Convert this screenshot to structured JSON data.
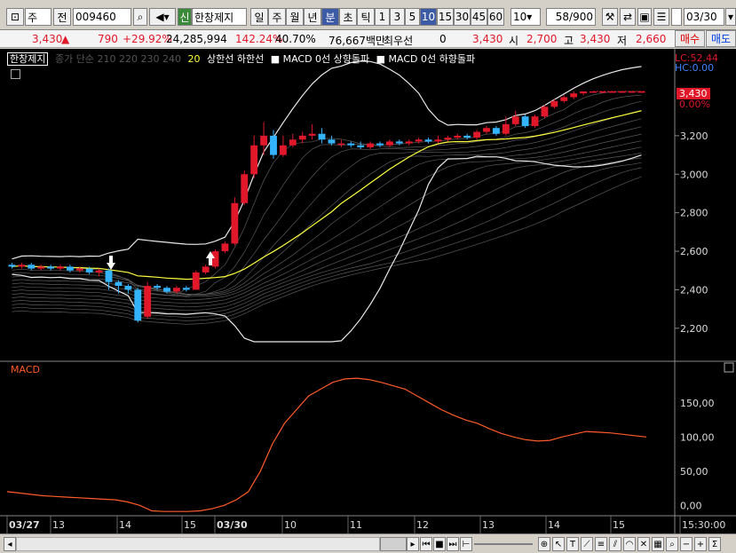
{
  "toolbar": {
    "period_type": "주",
    "market": "전",
    "code": "009460",
    "badge": "신",
    "name": "한창제지",
    "periods": [
      "일",
      "주",
      "월",
      "년",
      "분",
      "초",
      "틱"
    ],
    "active_period": "분",
    "intervals": [
      "1",
      "3",
      "5",
      "10",
      "15",
      "30",
      "45",
      "60"
    ],
    "active_interval": "10",
    "count_select": "10",
    "page_count": "58",
    "page_total": "/900",
    "date_value": "03/30"
  },
  "infobar": {
    "price": "3,430",
    "change": "790",
    "change_pct": "+29.92%",
    "volume": "24,285,994",
    "vol_ratio": "142.24%",
    "turnover": "40.70%",
    "amount": "76,667백만",
    "priority_label": "최우선",
    "priority_value": "0",
    "ask_price": "3,430",
    "open_label": "시",
    "open_value": "2,700",
    "high_label": "고",
    "high_value": "3,430",
    "low_label": "저",
    "low_value": "2,660",
    "buy_button": "매수",
    "sell_button": "매도"
  },
  "legend": {
    "stock_name": "한창제지",
    "ma_label": "종가 단순",
    "ma_periods": [
      "210",
      "220",
      "230",
      "240"
    ],
    "ma_20": "20",
    "upper_lower": "상한선  하한선",
    "macd_up": "MACD 0선 상향돌파",
    "macd_down": "MACD 0선 하향돌파"
  },
  "indicators": {
    "lc": "LC:52.44",
    "hc": "HC:0.00",
    "current_price": "3,430",
    "current_pct": "0.00%"
  },
  "macd": {
    "title": "MACD"
  },
  "chart_data": {
    "type": "candlestick",
    "price_axis": {
      "ticks": [
        3200,
        3000,
        2800,
        2600,
        2400,
        2200
      ],
      "labels": [
        "3,200",
        "3,000",
        "2,800",
        "2,600",
        "2,400",
        "2,200"
      ],
      "ylim": [
        2100,
        3430
      ]
    },
    "time_axis": [
      "03/27",
      "13",
      "14",
      "15",
      "03/30",
      "10",
      "11",
      "12",
      "13",
      "14",
      "15",
      "15:30:00"
    ],
    "macd_axis": {
      "ticks": [
        150,
        100,
        50,
        0
      ],
      "labels": [
        "150,00",
        "100,00",
        "50,00",
        "0,00"
      ]
    },
    "candles": [
      {
        "o": 2530,
        "c": 2520,
        "h": 2540,
        "l": 2510
      },
      {
        "o": 2520,
        "c": 2530,
        "h": 2540,
        "l": 2510
      },
      {
        "o": 2530,
        "c": 2510,
        "h": 2540,
        "l": 2500
      },
      {
        "o": 2510,
        "c": 2520,
        "h": 2530,
        "l": 2500
      },
      {
        "o": 2520,
        "c": 2510,
        "h": 2530,
        "l": 2500
      },
      {
        "o": 2510,
        "c": 2520,
        "h": 2530,
        "l": 2500
      },
      {
        "o": 2520,
        "c": 2500,
        "h": 2530,
        "l": 2490
      },
      {
        "o": 2500,
        "c": 2510,
        "h": 2520,
        "l": 2490
      },
      {
        "o": 2510,
        "c": 2490,
        "h": 2520,
        "l": 2480
      },
      {
        "o": 2490,
        "c": 2500,
        "h": 2510,
        "l": 2470
      },
      {
        "o": 2500,
        "c": 2440,
        "h": 2510,
        "l": 2400
      },
      {
        "o": 2440,
        "c": 2420,
        "h": 2450,
        "l": 2380
      },
      {
        "o": 2420,
        "c": 2400,
        "h": 2430,
        "l": 2380
      },
      {
        "o": 2400,
        "c": 2240,
        "h": 2410,
        "l": 2230
      },
      {
        "o": 2260,
        "c": 2420,
        "h": 2440,
        "l": 2250
      },
      {
        "o": 2420,
        "c": 2410,
        "h": 2430,
        "l": 2400
      },
      {
        "o": 2410,
        "c": 2390,
        "h": 2420,
        "l": 2380
      },
      {
        "o": 2390,
        "c": 2410,
        "h": 2420,
        "l": 2380
      },
      {
        "o": 2410,
        "c": 2400,
        "h": 2420,
        "l": 2390
      },
      {
        "o": 2400,
        "c": 2490,
        "h": 2500,
        "l": 2400
      },
      {
        "o": 2490,
        "c": 2520,
        "h": 2530,
        "l": 2480
      },
      {
        "o": 2520,
        "c": 2600,
        "h": 2610,
        "l": 2510
      },
      {
        "o": 2600,
        "c": 2640,
        "h": 2650,
        "l": 2590
      },
      {
        "o": 2640,
        "c": 2850,
        "h": 2880,
        "l": 2630
      },
      {
        "o": 2850,
        "c": 3000,
        "h": 3020,
        "l": 2840
      },
      {
        "o": 3000,
        "c": 3150,
        "h": 3200,
        "l": 2980
      },
      {
        "o": 3150,
        "c": 3200,
        "h": 3270,
        "l": 3100
      },
      {
        "o": 3200,
        "c": 3100,
        "h": 3230,
        "l": 3080
      },
      {
        "o": 3100,
        "c": 3150,
        "h": 3200,
        "l": 3090
      },
      {
        "o": 3150,
        "c": 3180,
        "h": 3210,
        "l": 3140
      },
      {
        "o": 3180,
        "c": 3200,
        "h": 3220,
        "l": 3160
      },
      {
        "o": 3200,
        "c": 3210,
        "h": 3260,
        "l": 3180
      },
      {
        "o": 3210,
        "c": 3180,
        "h": 3240,
        "l": 3160
      },
      {
        "o": 3180,
        "c": 3160,
        "h": 3200,
        "l": 3150
      },
      {
        "o": 3160,
        "c": 3160,
        "h": 3180,
        "l": 3140
      },
      {
        "o": 3160,
        "c": 3150,
        "h": 3170,
        "l": 3140
      },
      {
        "o": 3150,
        "c": 3140,
        "h": 3170,
        "l": 3130
      },
      {
        "o": 3140,
        "c": 3160,
        "h": 3170,
        "l": 3130
      },
      {
        "o": 3160,
        "c": 3150,
        "h": 3170,
        "l": 3140
      },
      {
        "o": 3150,
        "c": 3170,
        "h": 3180,
        "l": 3140
      },
      {
        "o": 3170,
        "c": 3160,
        "h": 3180,
        "l": 3150
      },
      {
        "o": 3160,
        "c": 3170,
        "h": 3180,
        "l": 3150
      },
      {
        "o": 3170,
        "c": 3180,
        "h": 3190,
        "l": 3160
      },
      {
        "o": 3180,
        "c": 3170,
        "h": 3190,
        "l": 3160
      },
      {
        "o": 3170,
        "c": 3180,
        "h": 3200,
        "l": 3160
      },
      {
        "o": 3180,
        "c": 3190,
        "h": 3200,
        "l": 3170
      },
      {
        "o": 3190,
        "c": 3200,
        "h": 3210,
        "l": 3180
      },
      {
        "o": 3200,
        "c": 3190,
        "h": 3210,
        "l": 3180
      },
      {
        "o": 3190,
        "c": 3220,
        "h": 3230,
        "l": 3180
      },
      {
        "o": 3220,
        "c": 3240,
        "h": 3250,
        "l": 3210
      },
      {
        "o": 3240,
        "c": 3210,
        "h": 3250,
        "l": 3200
      },
      {
        "o": 3210,
        "c": 3260,
        "h": 3300,
        "l": 3200
      },
      {
        "o": 3260,
        "c": 3300,
        "h": 3330,
        "l": 3250
      },
      {
        "o": 3300,
        "c": 3250,
        "h": 3310,
        "l": 3240
      },
      {
        "o": 3250,
        "c": 3300,
        "h": 3310,
        "l": 3240
      },
      {
        "o": 3300,
        "c": 3350,
        "h": 3360,
        "l": 3290
      },
      {
        "o": 3350,
        "c": 3380,
        "h": 3390,
        "l": 3340
      },
      {
        "o": 3380,
        "c": 3400,
        "h": 3410,
        "l": 3370
      },
      {
        "o": 3400,
        "c": 3420,
        "h": 3430,
        "l": 3390
      },
      {
        "o": 3420,
        "c": 3430,
        "h": 3430,
        "l": 3410
      },
      {
        "o": 3430,
        "c": 3430,
        "h": 3430,
        "l": 3430
      },
      {
        "o": 3430,
        "c": 3430,
        "h": 3430,
        "l": 3430
      },
      {
        "o": 3430,
        "c": 3430,
        "h": 3430,
        "l": 3430
      },
      {
        "o": 3430,
        "c": 3430,
        "h": 3430,
        "l": 3430
      },
      {
        "o": 3430,
        "c": 3430,
        "h": 3430,
        "l": 3430
      },
      {
        "o": 3430,
        "c": 3430,
        "h": 3430,
        "l": 3430
      }
    ],
    "macd_values": [
      20,
      18,
      16,
      14,
      13,
      12,
      11,
      10,
      9,
      8,
      5,
      0,
      -8,
      -9,
      -9,
      -9,
      -8,
      -5,
      0,
      8,
      20,
      50,
      90,
      120,
      140,
      160,
      170,
      180,
      185,
      186,
      184,
      180,
      175,
      170,
      160,
      150,
      140,
      132,
      125,
      120,
      112,
      105,
      100,
      96,
      94,
      95,
      100,
      104,
      108,
      107,
      106,
      104,
      102,
      100
    ]
  }
}
